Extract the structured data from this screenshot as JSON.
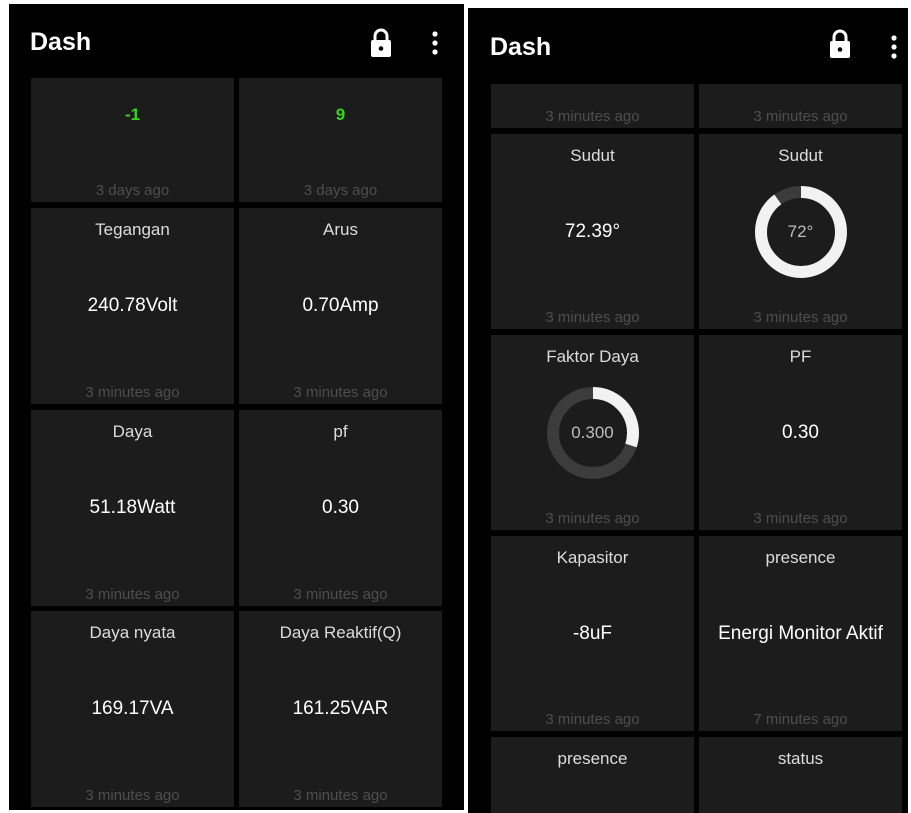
{
  "left_screen": {
    "app_bar": {
      "title": "Dash",
      "lock_icon": "lock-icon",
      "menu_icon": "more-vert-icon"
    },
    "tiles": [
      {
        "title": "",
        "value": "-1",
        "time": "3 days ago",
        "value_color": "#39d41c"
      },
      {
        "title": "",
        "value": "9",
        "time": "3 days ago",
        "value_color": "#39d41c"
      },
      {
        "title": "Tegangan",
        "value": "240.78Volt",
        "time": "3 minutes ago"
      },
      {
        "title": "Arus",
        "value": "0.70Amp",
        "time": "3 minutes ago"
      },
      {
        "title": "Daya",
        "value": "51.18Watt",
        "time": "3 minutes ago"
      },
      {
        "title": "pf",
        "value": "0.30",
        "time": "3 minutes ago"
      },
      {
        "title": "Daya nyata",
        "value": "169.17VA",
        "time": "3 minutes ago"
      },
      {
        "title": "Daya Reaktif(Q)",
        "value": "161.25VAR",
        "time": "3 minutes ago"
      }
    ]
  },
  "right_screen": {
    "app_bar": {
      "title": "Dash",
      "lock_icon": "lock-icon",
      "menu_icon": "more-vert-icon"
    },
    "tiles": [
      {
        "title": "",
        "value": "",
        "time": "3 minutes ago"
      },
      {
        "title": "",
        "value": "",
        "time": "3 minutes ago"
      },
      {
        "title": "Sudut",
        "value": "72.39°",
        "time": "3 minutes ago"
      },
      {
        "title": "Sudut",
        "gauge_label": "72°",
        "gauge_fraction": 0.9,
        "time": "3 minutes ago"
      },
      {
        "title": "Faktor Daya",
        "gauge_label": "0.300",
        "gauge_fraction": 0.3,
        "time": "3 minutes ago"
      },
      {
        "title": "PF",
        "value": "0.30",
        "time": "3 minutes ago"
      },
      {
        "title": "Kapasitor",
        "value": "-8uF",
        "time": "3 minutes ago"
      },
      {
        "title": "presence",
        "value": "Energi Monitor Aktif",
        "time": "7 minutes ago"
      },
      {
        "title": "presence",
        "value": "",
        "time": ""
      },
      {
        "title": "status",
        "value": "",
        "time": ""
      }
    ]
  },
  "colors": {
    "background": "#000000",
    "tile": "#1c1c1c",
    "gauge_fill": "#f2f2f2",
    "gauge_track": "#3c3c3c",
    "status_green": "#39d41c"
  }
}
